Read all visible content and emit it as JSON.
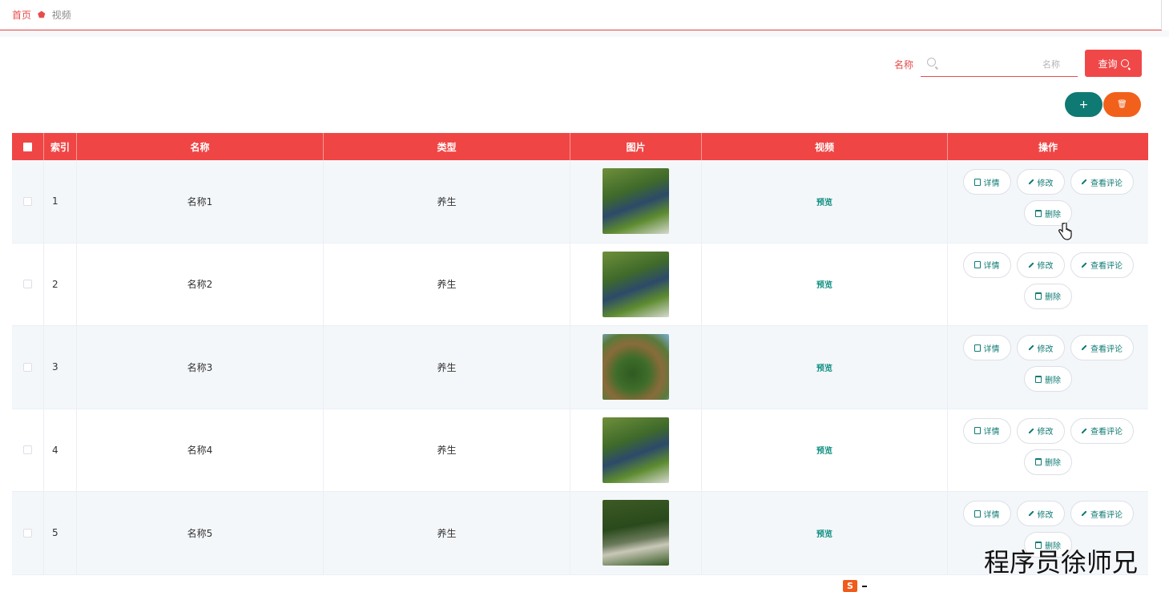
{
  "breadcrumb": {
    "home": "首页",
    "current": "视频"
  },
  "search": {
    "label": "名称",
    "placeholder": "名称",
    "button": "查询"
  },
  "toolbar": {
    "add": "+",
    "delete": "🗑"
  },
  "table": {
    "headers": [
      "索引",
      "名称",
      "类型",
      "图片",
      "视频",
      "操作"
    ],
    "rows": [
      {
        "index": "1",
        "name": "名称1",
        "type": "养生",
        "video": "预览"
      },
      {
        "index": "2",
        "name": "名称2",
        "type": "养生",
        "video": "预览"
      },
      {
        "index": "3",
        "name": "名称3",
        "type": "养生",
        "video": "预览"
      },
      {
        "index": "4",
        "name": "名称4",
        "type": "养生",
        "video": "预览"
      },
      {
        "index": "5",
        "name": "名称5",
        "type": "养生",
        "video": "预览"
      }
    ],
    "actions": {
      "detail": "详情",
      "edit": "修改",
      "comments": "查看评论",
      "remove": "删除"
    }
  },
  "watermark": "程序员徐师兄",
  "colors": {
    "accent": "#f04545",
    "teal": "#0f7a73",
    "orange": "#f2611b"
  }
}
